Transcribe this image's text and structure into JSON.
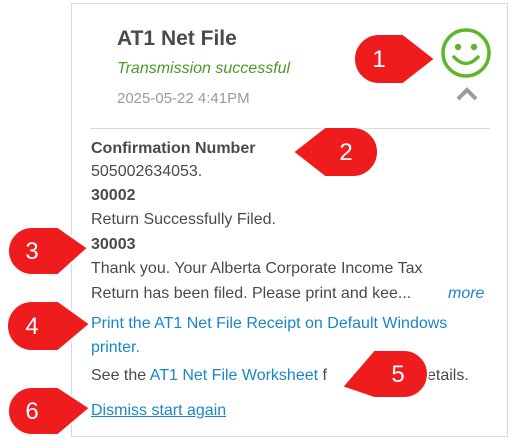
{
  "card": {
    "title": "AT1 Net File",
    "status": "Transmission successful",
    "timestamp": "2025-05-22 4:41PM",
    "status_icon": "smiley-face-icon",
    "collapse_icon": "chevron-up-icon",
    "accent_color": "#4a9a2a"
  },
  "messages": {
    "confirmation_label": "Confirmation Number",
    "confirmation_value": "505002634053.",
    "code1": "30002",
    "code1_text": "Return Successfully Filed.",
    "code2": "30003",
    "code2_line1": "Thank you. Your Alberta Corporate Income Tax",
    "code2_line2": "Return has been filed. Please print and kee...",
    "more": "more"
  },
  "actions": {
    "print_line1": "Print the AT1 Net File Receipt on Default Windows",
    "print_line2": "printer.",
    "see_prefix": "See the ",
    "worksheet_link": "AT1 Net File Worksheet",
    "see_suffix_visible": "f",
    "see_suffix_tail": "etails.",
    "dismiss": "Dismiss start again"
  },
  "callouts": [
    "1",
    "2",
    "3",
    "4",
    "5",
    "6"
  ]
}
